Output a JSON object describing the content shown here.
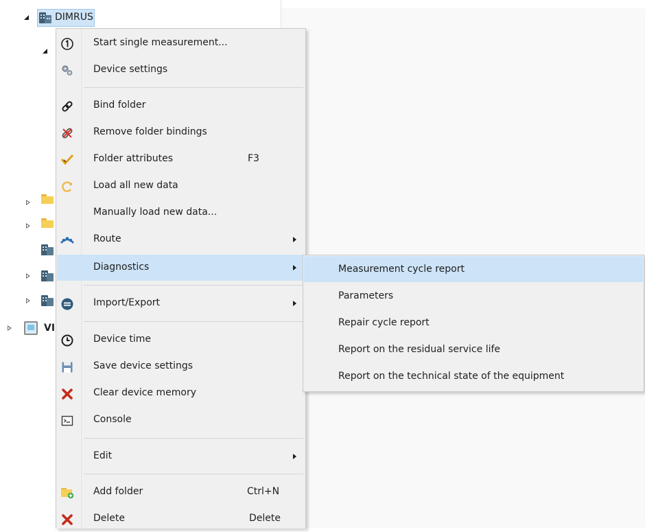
{
  "tree": {
    "root_label": "DIMRUS",
    "vi_label": "VI"
  },
  "context_menu": {
    "items": [
      {
        "label": "Start single measurement...",
        "icon": "number-one-icon"
      },
      {
        "label": "Device settings",
        "icon": "gears-icon"
      },
      {
        "label": "Bind folder",
        "icon": "link-icon"
      },
      {
        "label": "Remove folder bindings",
        "icon": "unlink-icon"
      },
      {
        "label": "Folder attributes",
        "shortcut": "F3",
        "icon": "check-pencil-icon"
      },
      {
        "label": "Load all new data",
        "icon": "refresh-icon"
      },
      {
        "label": "Manually load new data...",
        "icon": ""
      },
      {
        "label": "Route",
        "icon": "route-icon"
      },
      {
        "label": "Diagnostics",
        "icon": ""
      },
      {
        "label": "Import/Export",
        "icon": "import-export-icon"
      },
      {
        "label": "Device time",
        "icon": "clock-icon"
      },
      {
        "label": "Save device settings",
        "icon": "floppy-disk-icon"
      },
      {
        "label": "Clear device memory",
        "icon": "red-x-icon"
      },
      {
        "label": "Console",
        "icon": "console-icon"
      },
      {
        "label": "Edit",
        "icon": ""
      },
      {
        "label": "Add folder",
        "shortcut": "Ctrl+N",
        "icon": "add-folder-icon"
      },
      {
        "label": "Delete",
        "shortcut": "Delete",
        "icon": "red-x-icon"
      }
    ]
  },
  "diagnostics_submenu": {
    "items": [
      {
        "label": "Measurement cycle report"
      },
      {
        "label": "Parameters"
      },
      {
        "label": "Repair cycle report"
      },
      {
        "label": "Report on the residual service life"
      },
      {
        "label": "Report on the technical state of the equipment"
      }
    ]
  },
  "colors": {
    "highlight": "#cde3f7",
    "menu_background": "#f0f0f0",
    "danger": "#c42b1c"
  }
}
